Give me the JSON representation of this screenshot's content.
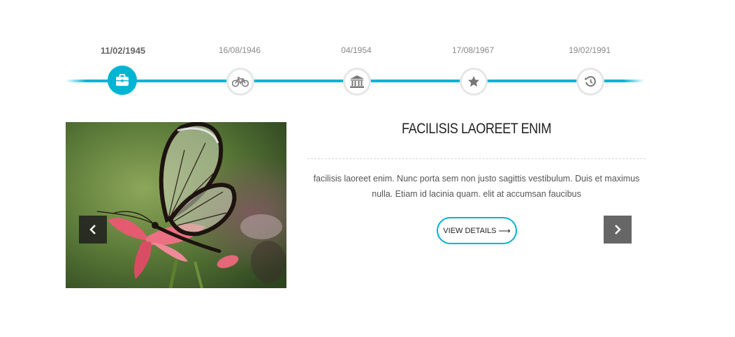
{
  "timeline": {
    "items": [
      {
        "date": "11/02/1945",
        "icon": "briefcase-icon",
        "active": true
      },
      {
        "date": "16/08/1946",
        "icon": "bicycle-icon",
        "active": false
      },
      {
        "date": "04/1954",
        "icon": "bank-icon",
        "active": false
      },
      {
        "date": "17/08/1967",
        "icon": "star-icon",
        "active": false
      },
      {
        "date": "19/02/1991",
        "icon": "history-icon",
        "active": false
      }
    ],
    "accent_color": "#00b4d4"
  },
  "slide": {
    "image": "butterfly-on-flower",
    "title": "FACILISIS LAOREET ENIM",
    "description": "facilisis laoreet enim. Nunc porta sem non justo sagittis vestibulum. Duis et maximus nulla. Etiam id lacinia quam. elit at accumsan faucibus",
    "button_label": "VIEW DETAILS",
    "button_arrow": "⟶"
  },
  "nav": {
    "prev_icon": "chevron-left-icon",
    "next_icon": "chevron-right-icon"
  }
}
